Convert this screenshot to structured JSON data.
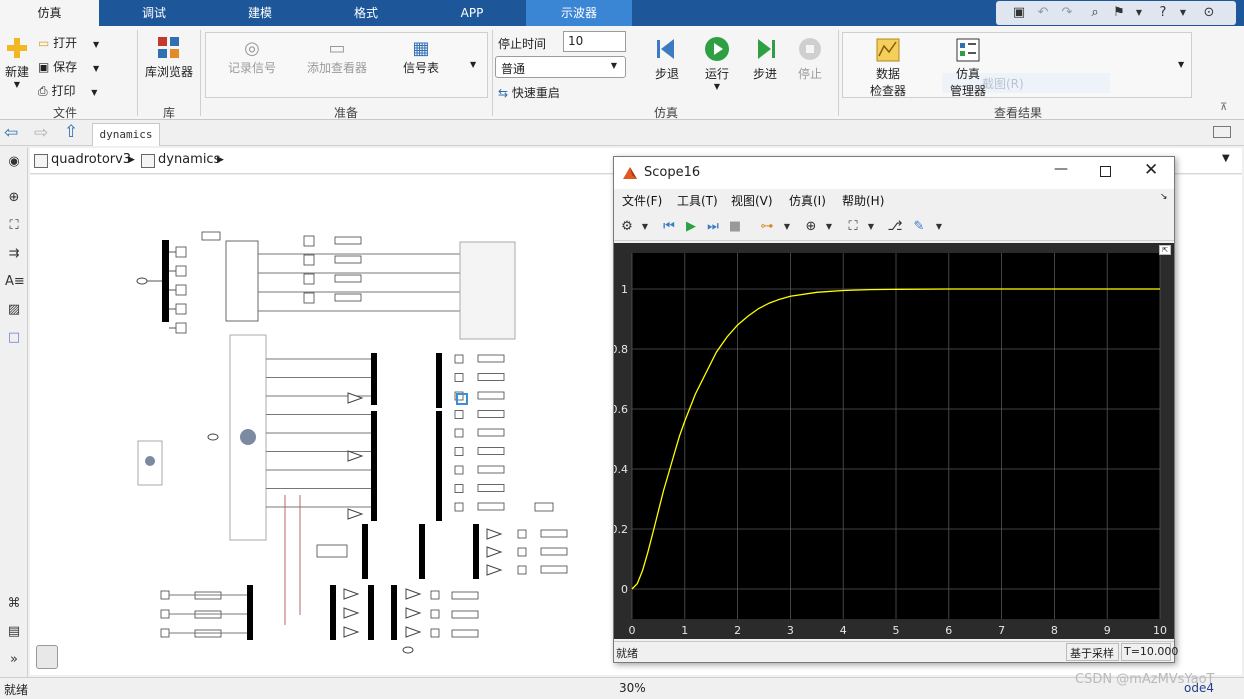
{
  "ribbon_tabs": [
    "仿真",
    "调试",
    "建模",
    "格式",
    "APP",
    "示波器"
  ],
  "file_group": {
    "new_label": "新建",
    "open_label": "打开",
    "save_label": "保存",
    "print_label": "打印",
    "group_label": "文件"
  },
  "library_group": {
    "browser_label": "库浏览器",
    "group_label": "库"
  },
  "prepare_group": {
    "log_signals_label": "记录信号",
    "add_viewer_label": "添加查看器",
    "signal_table_label": "信号表",
    "group_label": "准备"
  },
  "simulate_group": {
    "stop_time_label": "停止时间",
    "stop_time_value": "10",
    "mode_value": "普通",
    "fast_restart_label": "快速重启",
    "step_back_label": "步退",
    "run_label": "运行",
    "step_forward_label": "步进",
    "stop_label": "停止",
    "group_label": "仿真"
  },
  "results_group": {
    "data_inspector_line1": "数据",
    "data_inspector_line2": "检查器",
    "sim_manager_line1": "仿真",
    "sim_manager_line2": "管理器",
    "ghost_text": "截图(R)",
    "group_label": "查看结果"
  },
  "nav": {
    "tab_label": "dynamics"
  },
  "breadcrumb": [
    "quadrotorv3",
    "dynamics"
  ],
  "status": {
    "left": "就绪",
    "zoom": "30%",
    "solver": "ode4"
  },
  "watermark": "CSDN @mAzMVsYaoT",
  "scope": {
    "title": "Scope16",
    "menu": [
      "文件(F)",
      "工具(T)",
      "视图(V)",
      "仿真(I)",
      "帮助(H)"
    ],
    "status_left": "就绪",
    "status_mode": "基于采样",
    "status_time": "T=10.000"
  },
  "chart_data": {
    "type": "line",
    "title": "",
    "xlabel": "",
    "ylabel": "",
    "xlim": [
      0,
      10
    ],
    "ylim": [
      -0.1,
      1.12
    ],
    "xticks": [
      0,
      1,
      2,
      3,
      4,
      5,
      6,
      7,
      8,
      9,
      10
    ],
    "yticks": [
      0,
      0.2,
      0.4,
      0.6,
      0.8,
      1
    ],
    "grid": true,
    "background": "#000000",
    "series": [
      {
        "color": "#ffff00",
        "x": [
          0,
          0.1,
          0.2,
          0.3,
          0.4,
          0.5,
          0.6,
          0.7,
          0.8,
          0.9,
          1.0,
          1.2,
          1.4,
          1.6,
          1.8,
          2.0,
          2.2,
          2.4,
          2.6,
          2.8,
          3.0,
          3.5,
          4.0,
          4.5,
          5.0,
          6.0,
          7.0,
          8.0,
          9.0,
          10.0
        ],
        "y": [
          0,
          0.018,
          0.062,
          0.122,
          0.19,
          0.26,
          0.33,
          0.39,
          0.45,
          0.51,
          0.56,
          0.65,
          0.72,
          0.79,
          0.84,
          0.88,
          0.91,
          0.935,
          0.953,
          0.966,
          0.976,
          0.989,
          0.995,
          0.998,
          0.999,
          1,
          1,
          1,
          1,
          1
        ]
      }
    ]
  }
}
